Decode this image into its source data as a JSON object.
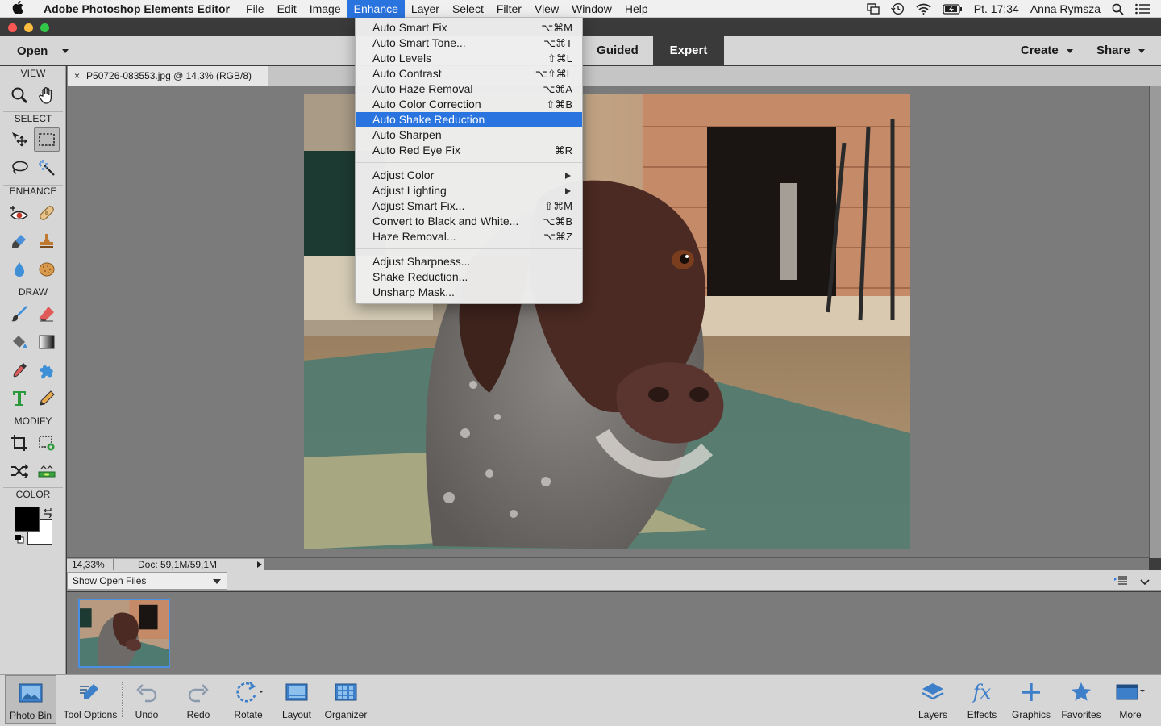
{
  "menubar": {
    "app_name": "Adobe Photoshop Elements Editor",
    "menus": [
      "File",
      "Edit",
      "Image",
      "Enhance",
      "Layer",
      "Select",
      "Filter",
      "View",
      "Window",
      "Help"
    ],
    "active_menu": "Enhance",
    "clock": "Pt. 17:34",
    "user": "Anna Rymsza"
  },
  "topbar": {
    "open_label": "Open",
    "modes": [
      "Guided",
      "Expert"
    ],
    "selected_mode": "Expert",
    "create_label": "Create",
    "share_label": "Share"
  },
  "tools": {
    "sections": [
      "VIEW",
      "SELECT",
      "ENHANCE",
      "DRAW",
      "MODIFY",
      "COLOR"
    ],
    "view": [
      "zoom-tool",
      "hand-tool"
    ],
    "select": [
      "move-tool",
      "rectangular-marquee-tool",
      "lasso-tool",
      "magic-wand-tool"
    ],
    "enhance": [
      "red-eye-tool",
      "spot-healing-brush-tool",
      "smart-brush-tool",
      "clone-stamp-tool",
      "blur-tool",
      "sponge-tool"
    ],
    "draw": [
      "brush-tool",
      "eraser-tool",
      "paint-bucket-tool",
      "gradient-tool",
      "eyedropper-tool",
      "custom-shape-tool",
      "type-tool",
      "pencil-tool"
    ],
    "modify": [
      "crop-tool",
      "recompose-tool",
      "content-aware-move-tool",
      "straighten-tool"
    ],
    "foreground_color": "#000000",
    "background_color": "#ffffff"
  },
  "document": {
    "tab_label": "P50726-083553.jpg @ 14,3% (RGB/8)",
    "zoom": "14,33%",
    "doc_size": "Doc: 59,1M/59,1M"
  },
  "photo_bin": {
    "filter_label": "Show Open Files"
  },
  "taskbar": {
    "left": [
      {
        "name": "photo-bin",
        "label": "Photo Bin"
      },
      {
        "name": "tool-options",
        "label": "Tool Options"
      },
      {
        "name": "undo",
        "label": "Undo"
      },
      {
        "name": "redo",
        "label": "Redo"
      },
      {
        "name": "rotate",
        "label": "Rotate"
      },
      {
        "name": "layout",
        "label": "Layout"
      },
      {
        "name": "organizer",
        "label": "Organizer"
      }
    ],
    "right": [
      {
        "name": "layers",
        "label": "Layers"
      },
      {
        "name": "effects",
        "label": "Effects"
      },
      {
        "name": "graphics",
        "label": "Graphics"
      },
      {
        "name": "favorites",
        "label": "Favorites"
      },
      {
        "name": "more",
        "label": "More"
      }
    ]
  },
  "enhance_menu": {
    "groups": [
      [
        {
          "label": "Auto Smart Fix",
          "shortcut": "⌥⌘M"
        },
        {
          "label": "Auto Smart Tone...",
          "shortcut": "⌥⌘T"
        },
        {
          "label": "Auto Levels",
          "shortcut": "⇧⌘L"
        },
        {
          "label": "Auto Contrast",
          "shortcut": "⌥⇧⌘L"
        },
        {
          "label": "Auto Haze Removal",
          "shortcut": "⌥⌘A"
        },
        {
          "label": "Auto Color Correction",
          "shortcut": "⇧⌘B"
        },
        {
          "label": "Auto Shake Reduction",
          "shortcut": "",
          "highlighted": true
        },
        {
          "label": "Auto Sharpen",
          "shortcut": ""
        },
        {
          "label": "Auto Red Eye Fix",
          "shortcut": "⌘R"
        }
      ],
      [
        {
          "label": "Adjust Color",
          "shortcut": "",
          "submenu": true
        },
        {
          "label": "Adjust Lighting",
          "shortcut": "",
          "submenu": true
        },
        {
          "label": "Adjust Smart Fix...",
          "shortcut": "⇧⌘M"
        },
        {
          "label": "Convert to Black and White...",
          "shortcut": "⌥⌘B"
        },
        {
          "label": "Haze Removal...",
          "shortcut": "⌥⌘Z"
        }
      ],
      [
        {
          "label": "Adjust Sharpness...",
          "shortcut": ""
        },
        {
          "label": "Shake Reduction...",
          "shortcut": ""
        },
        {
          "label": "Unsharp Mask...",
          "shortcut": ""
        }
      ]
    ]
  },
  "colors": {
    "accent": "#2a74e0",
    "panel": "#d6d6d6",
    "canvas_bg": "#7b7b7b"
  }
}
